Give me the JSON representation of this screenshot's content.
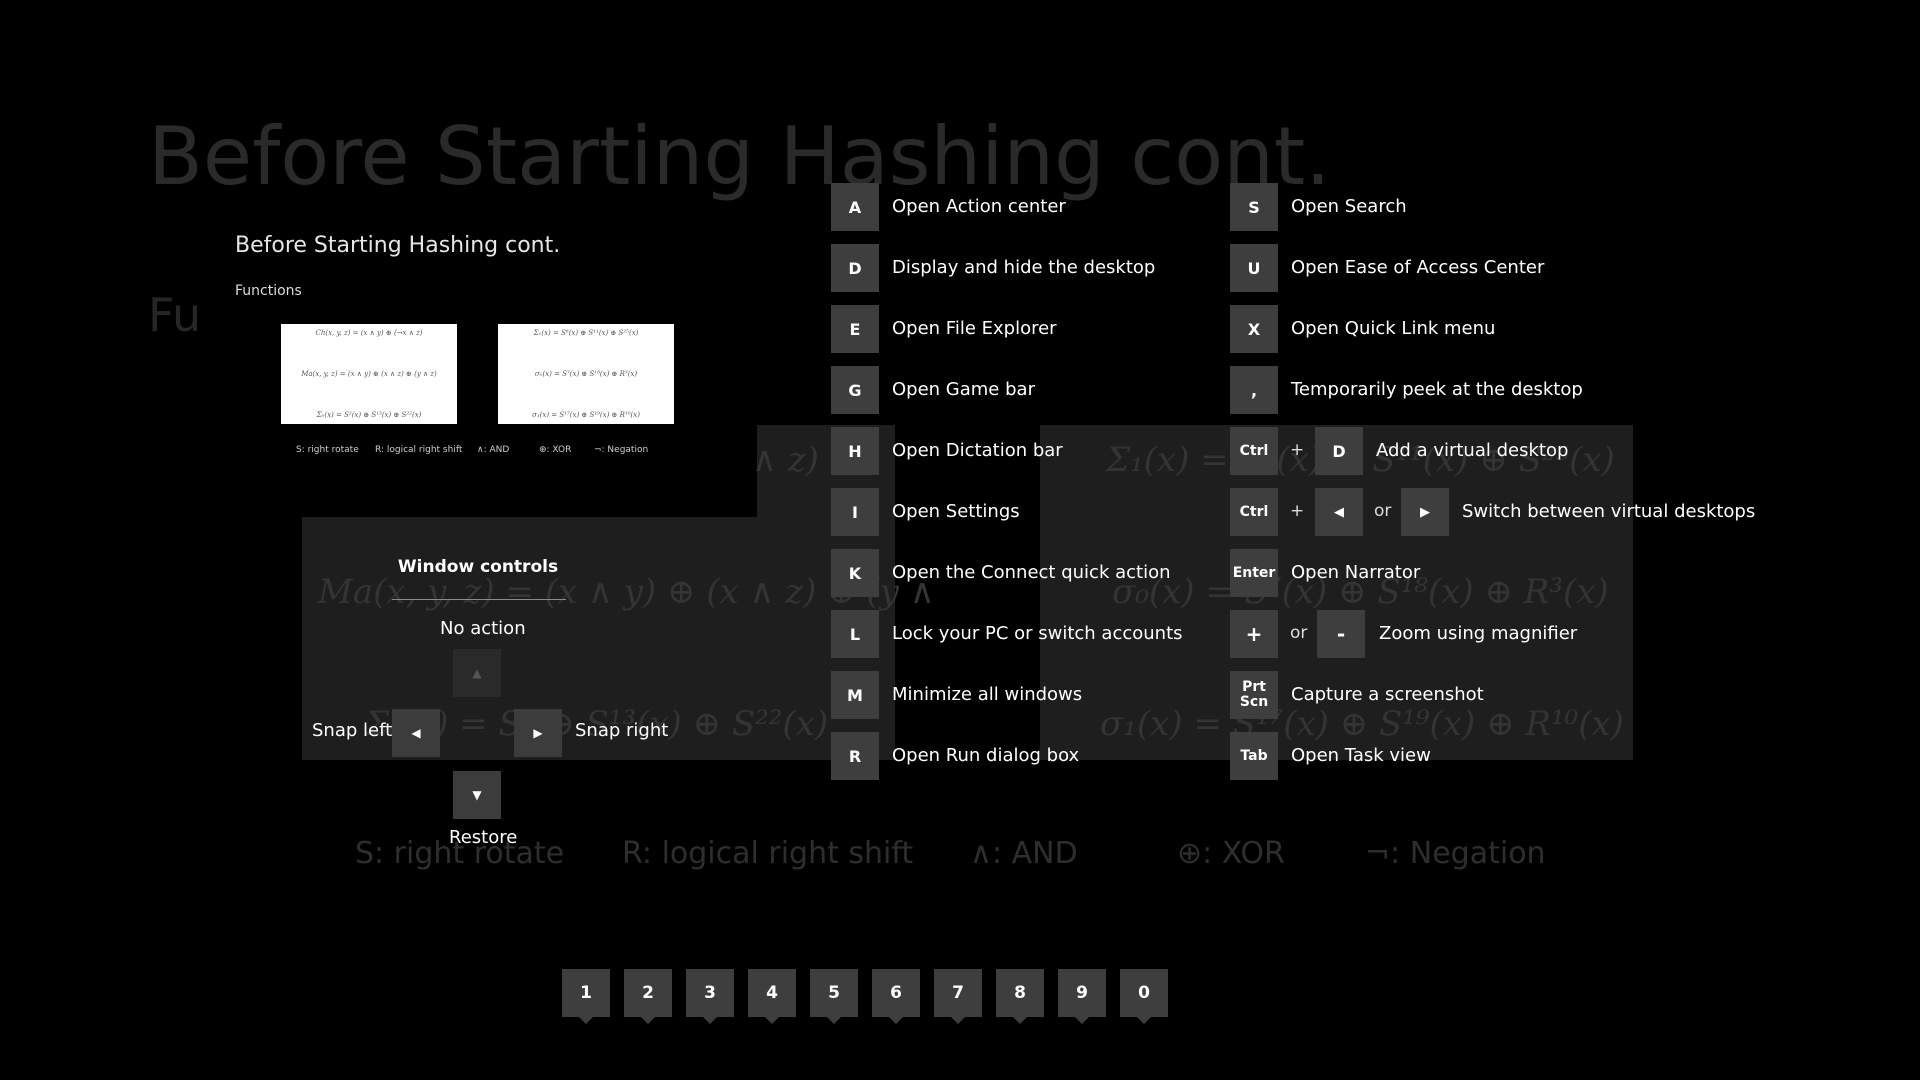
{
  "background_slide": {
    "title": "Before Starting Hashing cont.",
    "fu_fragment": "Fu",
    "formulas": {
      "ch_tail": "∧ z)",
      "ma": "Ma(x, y, z) = (x ∧ y) ⊕ (x ∧ z) ⊕ (y ∧",
      "sigma0_small": "Σ₀(x) = S² ⊕ S¹³(x) ⊕ S²²(x)",
      "Sigma1": "Σ₁(x) = S⁶(x) ⊕ S¹¹(x) ⊕ S²⁵(x)",
      "sigma0": "σ₀(x) = S⁷(x) ⊕ S¹⁸(x) ⊕ R³(x)",
      "sigma1": "σ₁(x) = S¹⁷(x) ⊕ S¹⁹(x) ⊕ R¹⁰(x)"
    },
    "legend": [
      "S: right rotate",
      "R: logical right shift",
      "∧: AND",
      "⊕: XOR",
      "¬: Negation"
    ]
  },
  "preview": {
    "title": "Before Starting Hashing cont.",
    "subtitle": "Functions",
    "left_box": [
      "Ch(x, y, z) = (x ∧ y) ⊕ (¬x ∧ z)",
      "Ma(x, y, z) = (x ∧ y) ⊕ (x ∧ z) ⊕ (y ∧ z)",
      "Σ₀(x) = S²(x) ⊕ S¹³(x) ⊕ S²²(x)"
    ],
    "right_box": [
      "Σ₁(x) = S⁶(x) ⊕ S¹¹(x) ⊕ S²⁵(x)",
      "σ₀(x) = S⁷(x) ⊕ S¹⁸(x) ⊕ R³(x)",
      "σ₁(x) = S¹⁷(x) ⊕ S¹⁹(x) ⊕ R¹⁰(x)"
    ],
    "legend": [
      "S: right rotate",
      "R: logical right shift",
      "∧: AND",
      "⊕: XOR",
      "¬: Negation"
    ]
  },
  "window_controls": {
    "title": "Window controls",
    "up_label": "No action",
    "left_label": "Snap left",
    "right_label": "Snap right",
    "down_label": "Restore"
  },
  "shortcuts_left": [
    {
      "key": "A",
      "label": "Open Action center"
    },
    {
      "key": "D",
      "label": "Display and hide the desktop"
    },
    {
      "key": "E",
      "label": "Open File Explorer"
    },
    {
      "key": "G",
      "label": "Open Game bar"
    },
    {
      "key": "H",
      "label": "Open Dictation bar"
    },
    {
      "key": "I",
      "label": "Open Settings"
    },
    {
      "key": "K",
      "label": "Open the Connect quick action"
    },
    {
      "key": "L",
      "label": "Lock your PC or switch accounts"
    },
    {
      "key": "M",
      "label": "Minimize all windows"
    },
    {
      "key": "R",
      "label": "Open Run dialog box"
    }
  ],
  "shortcuts_right": {
    "s": {
      "key": "S",
      "label": "Open Search"
    },
    "u": {
      "key": "U",
      "label": "Open Ease of Access Center"
    },
    "x": {
      "key": "X",
      "label": "Open Quick Link menu"
    },
    "comma": {
      "key": ",",
      "label": "Temporarily peek at the desktop"
    },
    "ctrl_d": {
      "key1": "Ctrl",
      "plus": "+",
      "key2": "D",
      "label": "Add a virtual desktop"
    },
    "ctrl_arrows": {
      "key1": "Ctrl",
      "plus": "+",
      "or": "or",
      "label": "Switch between virtual desktops"
    },
    "enter": {
      "key": "Enter",
      "label": "Open Narrator"
    },
    "zoom": {
      "key1": "+",
      "or": "or",
      "key2": "-",
      "label": "Zoom using magnifier"
    },
    "prtscn": {
      "key_line1": "Prt",
      "key_line2": "Scn",
      "label": "Capture a screenshot"
    },
    "tab": {
      "key": "Tab",
      "label": "Open Task view"
    }
  },
  "number_keys": [
    "1",
    "2",
    "3",
    "4",
    "5",
    "6",
    "7",
    "8",
    "9",
    "0"
  ]
}
